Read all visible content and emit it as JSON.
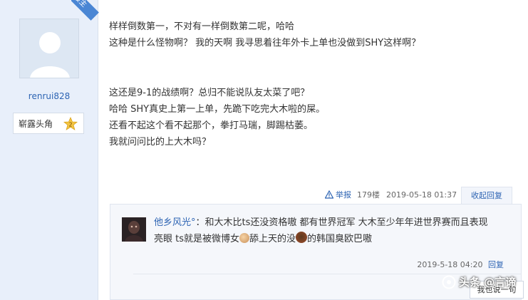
{
  "author": {
    "badge": "楼主",
    "username": "renrui828",
    "rank_title": "崭露头角",
    "rank_level": "2"
  },
  "post": {
    "lines_a": [
      "样样倒数第一，不对有一样倒数第二呢，哈哈",
      "这种是什么怪物啊？ 我的天啊 我寻思着往年外卡上单也没做到SHY这样啊？"
    ],
    "lines_b": [
      "这还是9-1的战绩啊？总归不能说队友太菜了吧？",
      "哈哈 SHY真史上第一上单，先跪下吃完大木啦的屎。",
      "还看不起这个看不起那个，拳打马瑞，脚踢枯萎。",
      "我就问问比的上大木吗？"
    ],
    "report_label": "举报",
    "floor": "179楼",
    "time": "2019-05-18 01:37",
    "collapse_label": "收起回复"
  },
  "reply": {
    "name": "他乡风光°",
    "text_1": "：和大木比ts还没资格嗷 都有世界冠军 大木至少年年进世界赛而且表现",
    "text_2a": "亮眼 ts就是被微博女",
    "text_2b": "舔上天的没",
    "text_2c": "的韩国臭欧巴嗷",
    "time": "2019-5-18 04:20",
    "reply_label": "回复"
  },
  "say_button": "我也说一句",
  "watermark": "头条 @言谛"
}
